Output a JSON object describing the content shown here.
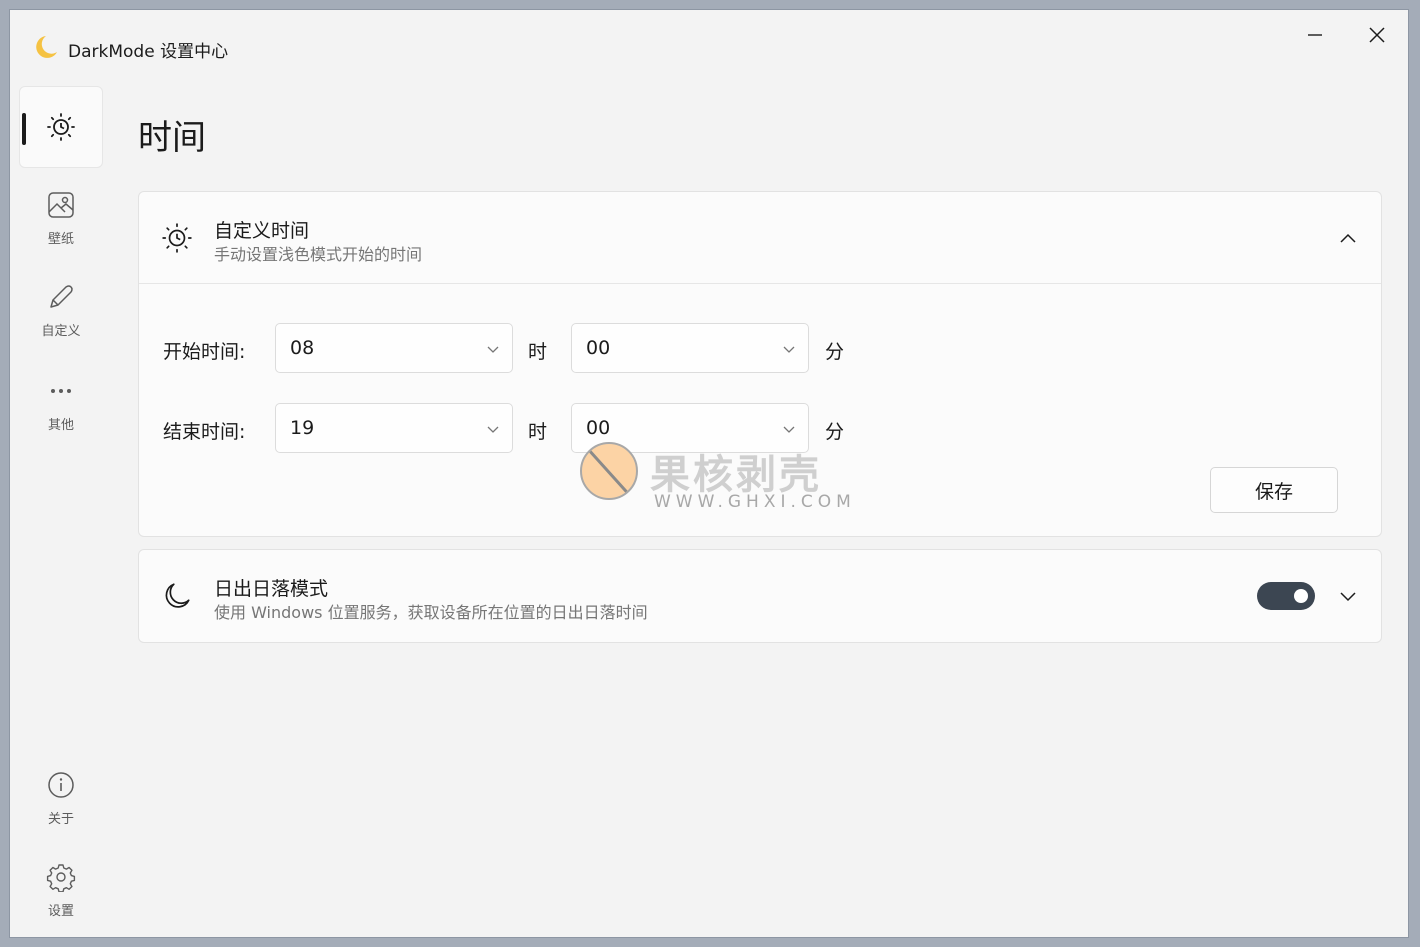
{
  "app": {
    "title": "DarkMode 设置中心"
  },
  "window_controls": {
    "minimize_icon": "minimize-icon",
    "close_icon": "close-icon"
  },
  "nav": {
    "active_icon": "sun-clock-icon",
    "items": [
      {
        "label": "壁纸",
        "icon": "wallpaper-icon"
      },
      {
        "label": "自定义",
        "icon": "pen-icon"
      },
      {
        "label": "其他",
        "icon": "more-icon"
      },
      {
        "label": "关于",
        "icon": "info-icon"
      },
      {
        "label": "设置",
        "icon": "gear-icon"
      }
    ]
  },
  "page": {
    "title": "时间"
  },
  "custom_time": {
    "title": "自定义时间",
    "subtitle": "手动设置浅色模式开始的时间",
    "expanded": true,
    "start_label": "开始时间:",
    "end_label": "结束时间:",
    "start_hour": "08",
    "start_minute": "00",
    "end_hour": "19",
    "end_minute": "00",
    "hour_unit": "时",
    "minute_unit": "分",
    "save_label": "保存"
  },
  "sun_mode": {
    "title": "日出日落模式",
    "subtitle": "使用 Windows 位置服务，获取设备所在位置的日出日落时间",
    "toggle_on": true
  },
  "watermark": {
    "cn": "果核剥壳",
    "en": "WWW.GHXI.COM"
  },
  "colors": {
    "toggle_on": "#3c4652",
    "accent_moon": "#f5c242",
    "background": "#f3f3f3"
  }
}
